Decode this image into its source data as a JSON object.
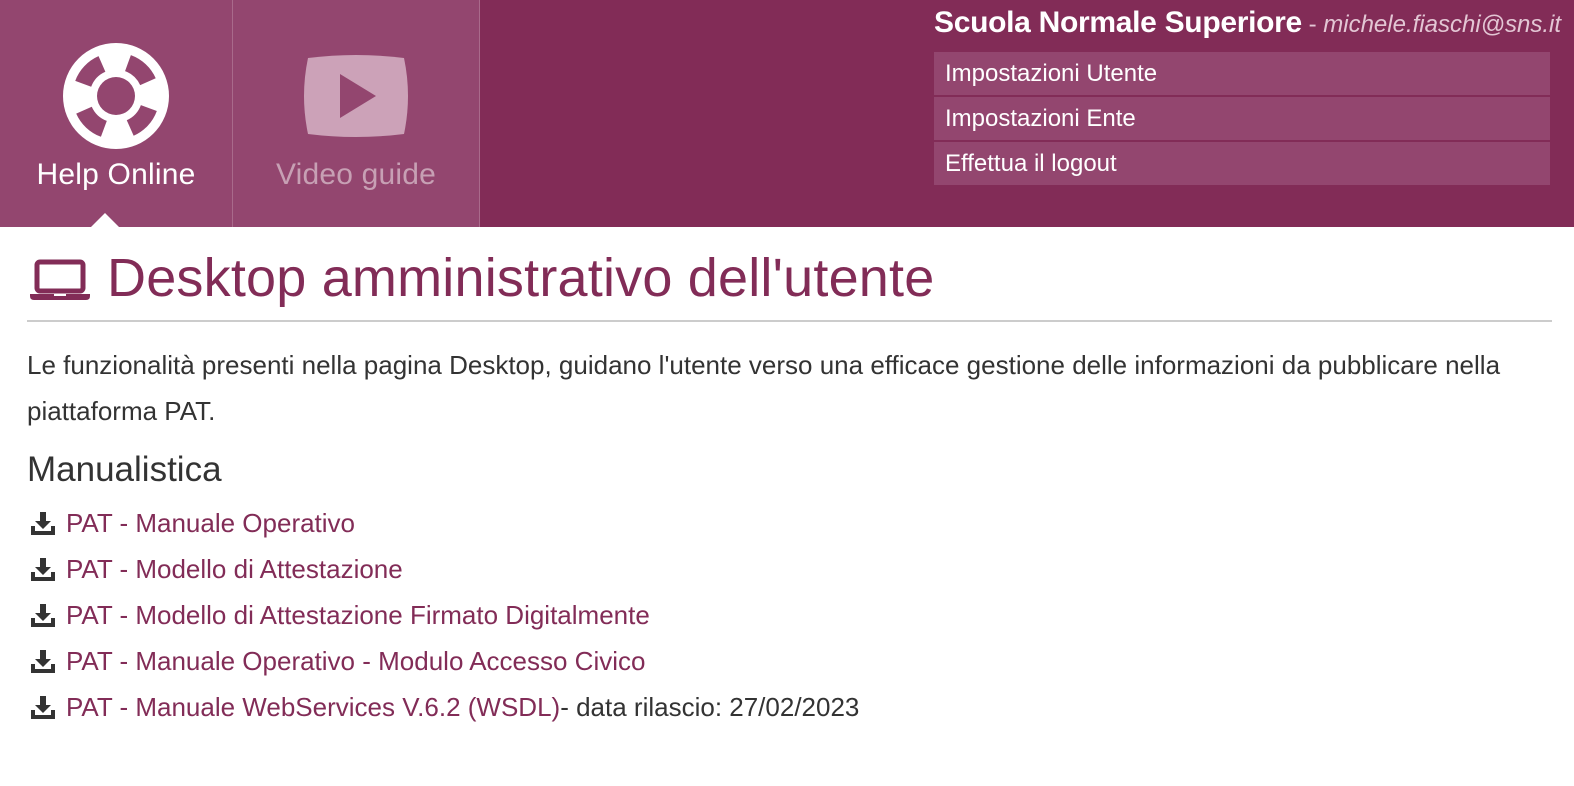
{
  "header": {
    "tabs": [
      {
        "label": "Help Online",
        "icon": "lifebuoy-icon",
        "active": true
      },
      {
        "label": "Video guide",
        "icon": "play-video-icon",
        "active": false
      }
    ],
    "organization": "Scuola Normale Superiore",
    "separator": " - ",
    "user_email": "michele.fiaschi@sns.it",
    "user_menu": [
      {
        "label": "Impostazioni Utente"
      },
      {
        "label": "Impostazioni Ente"
      },
      {
        "label": "Effettua il logout"
      }
    ]
  },
  "page": {
    "title": "Desktop amministrativo dell'utente",
    "title_icon": "laptop-icon",
    "intro": "Le funzionalità presenti nella pagina Desktop, guidano l'utente verso una efficace gestione delle informazioni da pubblicare nella piattaforma PAT.",
    "section_title": "Manualistica",
    "documents": [
      {
        "label": "PAT - Manuale Operativo",
        "note": ""
      },
      {
        "label": "PAT - Modello di Attestazione",
        "note": ""
      },
      {
        "label": "PAT - Modello di Attestazione Firmato Digitalmente",
        "note": ""
      },
      {
        "label": "PAT - Manuale Operativo - Modulo Accesso Civico",
        "note": ""
      },
      {
        "label": "PAT - Manuale WebServices V.6.2 (WSDL)",
        "note": " - data rilascio: 27/02/2023"
      }
    ]
  },
  "colors": {
    "brand": "#822c57",
    "tab_background": "#93466f",
    "text": "#333333",
    "muted_header_text": "#e3c6d4"
  }
}
